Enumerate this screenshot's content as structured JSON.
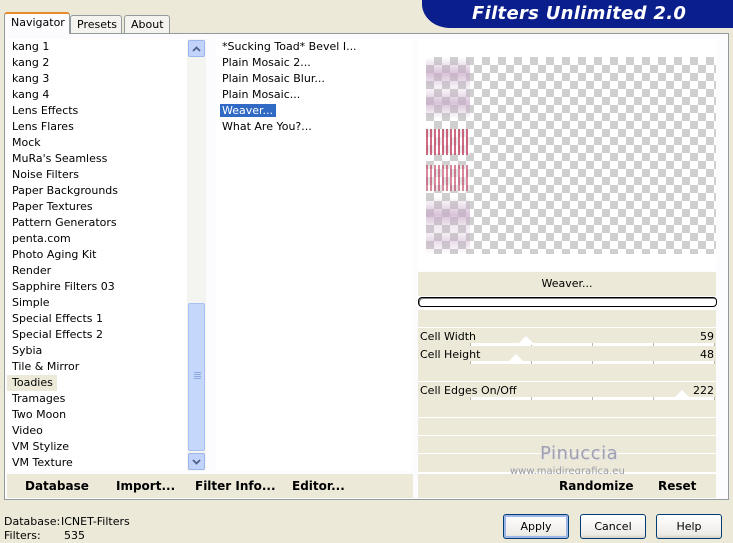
{
  "tabs": [
    {
      "label": "Navigator"
    },
    {
      "label": "Presets"
    },
    {
      "label": "About"
    }
  ],
  "header": {
    "title": "Filters Unlimited 2.0"
  },
  "categories": [
    "kang 1",
    "kang 2",
    "kang 3",
    "kang 4",
    "Lens Effects",
    "Lens Flares",
    "Mock",
    "MuRa's Seamless",
    "Noise Filters",
    "Paper Backgrounds",
    "Paper Textures",
    "Pattern Generators",
    "penta.com",
    "Photo Aging Kit",
    "Render",
    "Sapphire Filters 03",
    "Simple",
    "Special Effects 1",
    "Special Effects 2",
    "Sybia",
    "Tile & Mirror",
    "Toadies",
    "Tramages",
    "Two Moon",
    "Video",
    "VM Stylize",
    "VM Texture"
  ],
  "selected_category": "Toadies",
  "filters": [
    "*Sucking Toad* Bevel I...",
    "Plain Mosaic 2...",
    "Plain Mosaic Blur...",
    "Plain Mosaic...",
    "Weaver...",
    "What Are You?..."
  ],
  "selected_filter": "Weaver...",
  "current_filter_name": "Weaver...",
  "sliders": [
    {
      "label": "Cell Width",
      "value": "59",
      "level": 59
    },
    {
      "label": "Cell Height",
      "value": "48",
      "level": 48
    },
    {
      "label": "Cell Edges On/Off",
      "value": "222",
      "level": 222
    }
  ],
  "left_buttons": {
    "database": "Database",
    "import": "Import...",
    "filter_info": "Filter Info...",
    "editor": "Editor..."
  },
  "right_buttons": {
    "randomize": "Randomize",
    "reset": "Reset"
  },
  "watermark": {
    "name": "Pinuccia",
    "site": "www.maidiregrafica.eu"
  },
  "status": {
    "database_label": "Database:",
    "database_value": "ICNET-Filters",
    "filters_label": "Filters:",
    "filters_value": "535"
  },
  "dialog_buttons": {
    "apply": "Apply",
    "cancel": "Cancel",
    "help": "Help"
  },
  "colors": {
    "banner": "#0a1e8c",
    "selection": "#316ac5",
    "panel": "#ece9d8"
  }
}
